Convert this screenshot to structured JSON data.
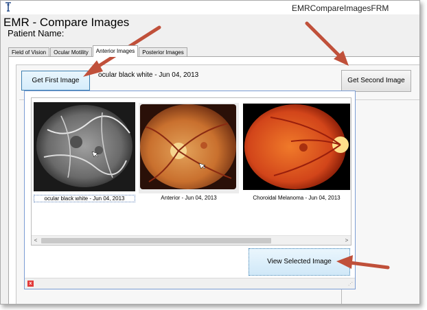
{
  "window": {
    "title": "EMRCompareImagesFRM",
    "icon": "app-icon"
  },
  "form": {
    "title": "EMR - Compare Images",
    "patient_label": "Patient Name:"
  },
  "tabs": [
    {
      "label": "Field of Vision",
      "active": false
    },
    {
      "label": "Ocular Motility",
      "active": false
    },
    {
      "label": "Anterior Images",
      "active": true
    },
    {
      "label": "Posterior Images",
      "active": false
    }
  ],
  "toolbar": {
    "first_button": "Get First Image",
    "first_caption": "ocular black white - Jun 04, 2013",
    "second_button": "Get Second Image"
  },
  "gallery": {
    "items": [
      {
        "caption": "ocular black white - Jun 04, 2013",
        "selected": true
      },
      {
        "caption": "Anterior - Jun 04, 2013",
        "selected": false
      },
      {
        "caption": "Choroidal Melanoma - Jun 04, 2013",
        "selected": false
      }
    ],
    "scroll_left": "<",
    "scroll_right": ">"
  },
  "popup": {
    "view_button": "View Selected Image",
    "close_glyph": "x"
  },
  "colors": {
    "annotation_arrow": "#c0503a",
    "accent_border": "#3c7fb1"
  }
}
